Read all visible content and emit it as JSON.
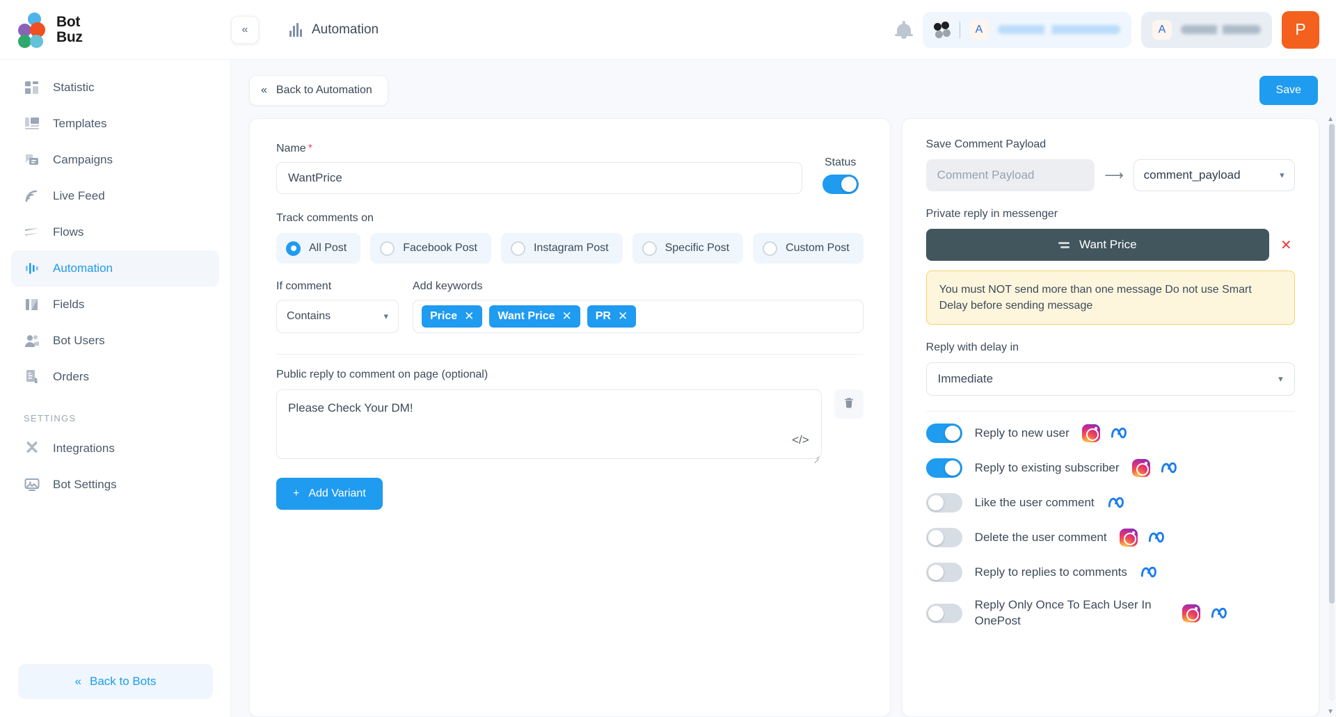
{
  "brand": {
    "line1": "Bot",
    "line2": "Buz"
  },
  "header": {
    "collapse_icon": "double-chevron-left-icon",
    "page_title": "Automation",
    "bell_icon": "notification-bell-icon",
    "workspace_icon": "pinwheel-icon",
    "account_initial": "A",
    "bot_initial": "A",
    "user_initial": "P"
  },
  "sidebar": {
    "items": [
      {
        "label": "Statistic",
        "icon": "grid-stats-icon",
        "active": false
      },
      {
        "label": "Templates",
        "icon": "template-icon",
        "active": false
      },
      {
        "label": "Campaigns",
        "icon": "megaphone-chat-icon",
        "active": false
      },
      {
        "label": "Live Feed",
        "icon": "rss-feed-icon",
        "active": false
      },
      {
        "label": "Flows",
        "icon": "flow-layers-icon",
        "active": false
      },
      {
        "label": "Automation",
        "icon": "bar-pulse-icon",
        "active": true
      },
      {
        "label": "Fields",
        "icon": "fields-icon",
        "active": false
      },
      {
        "label": "Bot Users",
        "icon": "users-icon",
        "active": false
      },
      {
        "label": "Orders",
        "icon": "orders-icon",
        "active": false
      }
    ],
    "settings_label": "SETTINGS",
    "settings_items": [
      {
        "label": "Integrations",
        "icon": "puzzle-cross-icon"
      },
      {
        "label": "Bot Settings",
        "icon": "monitor-icon"
      }
    ],
    "back_to_bots": {
      "label": "Back to Bots",
      "icon": "double-chevron-left-icon"
    }
  },
  "toolbar": {
    "back_label": "Back to Automation",
    "back_icon": "double-chevron-left-icon",
    "save_label": "Save"
  },
  "form": {
    "name_label": "Name",
    "name_required_mark": "*",
    "name_value": "WantPrice",
    "status_label": "Status",
    "status_on": true,
    "track_label": "Track comments on",
    "track_options": [
      {
        "label": "All Post",
        "selected": true
      },
      {
        "label": "Facebook Post",
        "selected": false
      },
      {
        "label": "Instagram Post",
        "selected": false
      },
      {
        "label": "Specific Post",
        "selected": false
      },
      {
        "label": "Custom Post",
        "selected": false
      }
    ],
    "if_comment_label": "If comment",
    "condition_value": "Contains",
    "add_keywords_label": "Add keywords",
    "keywords": [
      "Price",
      "Want Price",
      "PR"
    ],
    "keyword_remove_icon": "close-icon",
    "public_reply_label": "Public reply to comment on page (optional)",
    "public_reply_value": "Please Check Your DM!",
    "code_icon": "code-brackets-icon",
    "delete_icon": "trash-icon",
    "add_variant_label": "Add Variant",
    "add_variant_icon": "plus-icon"
  },
  "panel": {
    "save_payload_label": "Save Comment Payload",
    "payload_placeholder": "Comment Payload",
    "payload_arrow_icon": "arrow-right-icon",
    "payload_value": "comment_payload",
    "private_reply_label": "Private reply in messenger",
    "message_button_label": "Want Price",
    "message_button_icon": "flow-layers-icon",
    "message_remove_icon": "close-icon",
    "warning_text": "You must NOT send more than one message Do not use Smart Delay before sending message",
    "delay_label": "Reply with delay in",
    "delay_value": "Immediate",
    "options": [
      {
        "label": "Reply to new user",
        "on": true,
        "platforms": [
          "instagram",
          "meta"
        ]
      },
      {
        "label": "Reply to existing subscriber",
        "on": true,
        "platforms": [
          "instagram",
          "meta"
        ]
      },
      {
        "label": "Like the user comment",
        "on": false,
        "platforms": [
          "meta"
        ]
      },
      {
        "label": "Delete the user comment",
        "on": false,
        "platforms": [
          "instagram",
          "meta"
        ]
      },
      {
        "label": "Reply to replies to comments",
        "on": false,
        "platforms": [
          "meta"
        ]
      },
      {
        "label": "Reply Only Once To Each User In OnePost",
        "on": false,
        "platforms": [
          "instagram",
          "meta"
        ]
      }
    ]
  },
  "colors": {
    "accent": "#1f9bf0",
    "brand_orange": "#f4601e",
    "warning_bg": "#fdf6dd",
    "warning_border": "#f2d16b",
    "dark_button": "#42565d",
    "required": "#e8467c"
  }
}
